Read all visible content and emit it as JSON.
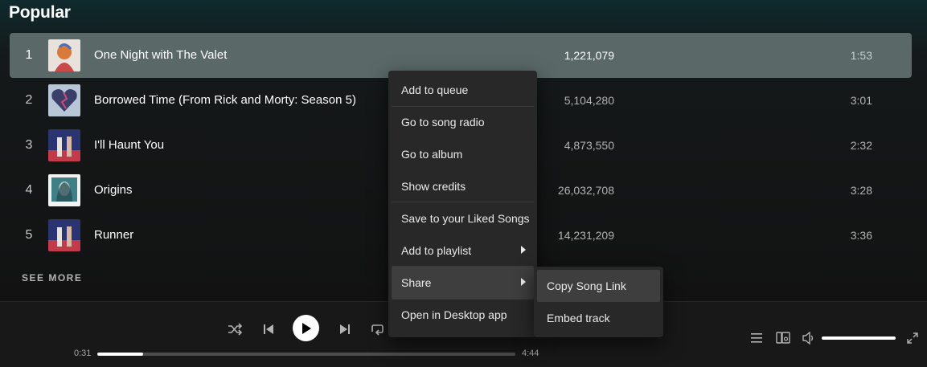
{
  "section_title": "Popular",
  "tracks": [
    {
      "num": "1",
      "title": "One Night with The Valet",
      "plays": "1,221,079",
      "duration": "1:53"
    },
    {
      "num": "2",
      "title": "Borrowed Time (From Rick and Morty: Season 5)",
      "plays": "5,104,280",
      "duration": "3:01"
    },
    {
      "num": "3",
      "title": "I'll Haunt You",
      "plays": "4,873,550",
      "duration": "2:32"
    },
    {
      "num": "4",
      "title": "Origins",
      "plays": "26,032,708",
      "duration": "3:28"
    },
    {
      "num": "5",
      "title": "Runner",
      "plays": "14,231,209",
      "duration": "3:36"
    }
  ],
  "see_more": "SEE MORE",
  "context_menu": {
    "items": [
      {
        "label": "Add to queue"
      },
      {
        "label": "Go to song radio"
      },
      {
        "label": "Go to album"
      },
      {
        "label": "Show credits"
      },
      {
        "label": "Save to your Liked Songs"
      },
      {
        "label": "Add to playlist",
        "has_submenu": true
      },
      {
        "label": "Share",
        "has_submenu": true,
        "highlighted": true
      },
      {
        "label": "Open in Desktop app"
      }
    ],
    "share_submenu": [
      {
        "label": "Copy Song Link",
        "highlighted": true
      },
      {
        "label": "Embed track"
      }
    ]
  },
  "player": {
    "elapsed": "0:31",
    "total": "4:44",
    "progress_fraction": 0.11,
    "volume_fraction": 1.0,
    "controls": [
      "shuffle-icon",
      "previous-icon",
      "play-icon",
      "next-icon",
      "repeat-icon"
    ],
    "right_controls": [
      "queue-icon",
      "devices-icon",
      "volume-icon",
      "fullscreen-icon"
    ]
  },
  "colors": {
    "selected_row": "#5a6868",
    "menu_bg": "#282828",
    "menu_hover": "#3e3e3e"
  }
}
